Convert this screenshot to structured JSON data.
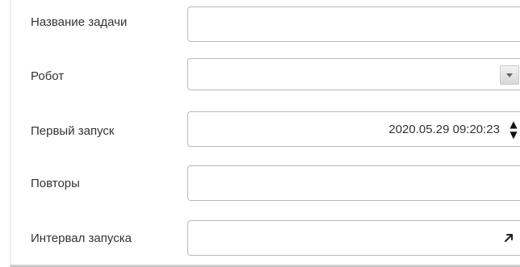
{
  "form": {
    "task_name": {
      "label": "Название задачи",
      "value": ""
    },
    "robot": {
      "label": "Робот",
      "selected_value": ""
    },
    "first_run": {
      "label": "Первый запуск",
      "value": "2020.05.29 09:20:23"
    },
    "repeats": {
      "label": "Повторы",
      "value": ""
    },
    "run_interval": {
      "label": "Интервал запуска",
      "value": ""
    }
  },
  "icons": {
    "select_arrow": "chevron-down-icon",
    "spinner": "up-down-spinner-icon",
    "expand": "arrow-up-right-icon"
  },
  "colors": {
    "border": "#b9b9b9",
    "label_text": "#333333",
    "background": "#ffffff"
  }
}
